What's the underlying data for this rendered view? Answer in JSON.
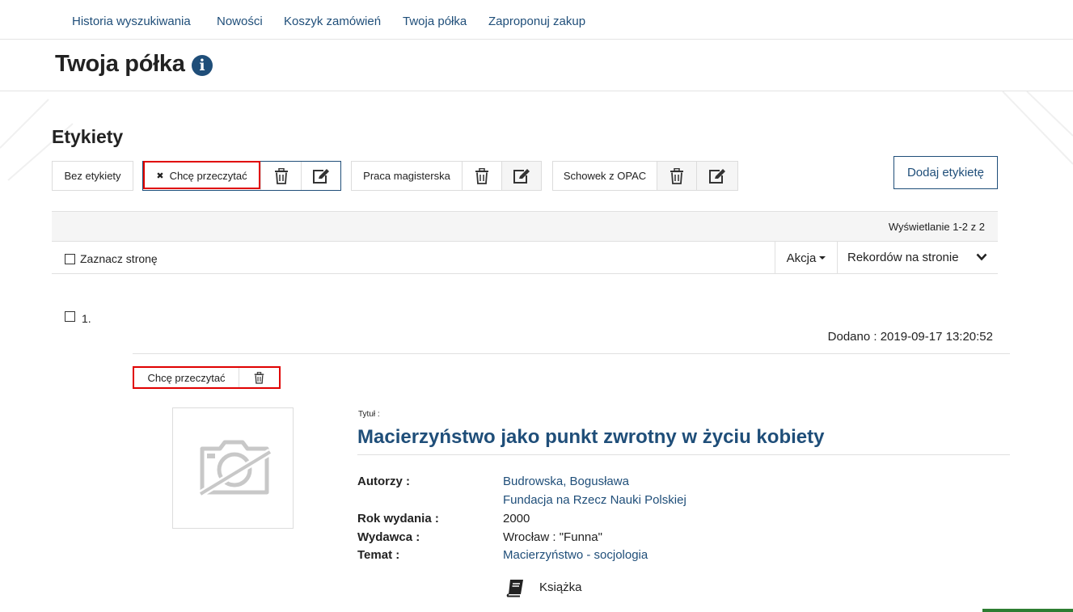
{
  "nav": {
    "items": [
      {
        "label": "Historia wyszukiwania"
      },
      {
        "label": "Nowości"
      },
      {
        "label": "Koszyk zamówień"
      },
      {
        "label": "Twoja półka"
      },
      {
        "label": "Zaproponuj zakup"
      }
    ]
  },
  "page": {
    "title": "Twoja półka",
    "info_icon_glyph": "i"
  },
  "labels_section": {
    "title": "Etykiety",
    "no_label": "Bez etykiety",
    "tags": [
      {
        "label": "Chcę przeczytać",
        "active": true,
        "remove_glyph": "✖"
      },
      {
        "label": "Praca magisterska",
        "active": false
      },
      {
        "label": "Schowek z OPAC",
        "active": false
      }
    ],
    "add_label_button": "Dodaj etykietę"
  },
  "results": {
    "count_text": "Wyświetlanie 1-2 z 2",
    "select_page_label": "Zaznacz stronę",
    "action_label": "Akcja",
    "per_page_label": "Rekordów na stronie"
  },
  "record": {
    "number": "1.",
    "added": "Dodano : 2019-09-17 13:20:52",
    "tag_label": "Chcę przeczytać",
    "title_label": "Tytuł :",
    "title": "Macierzyństwo jako punkt zwrotny w życiu kobiety",
    "fields": {
      "authors_label": "Autorzy :",
      "authors": [
        "Budrowska, Bogusława",
        "Fundacja na Rzecz Nauki Polskiej"
      ],
      "year_label": "Rok wydania :",
      "year": "2000",
      "publisher_label": "Wydawca :",
      "publisher": "Wrocław : \"Funna\"",
      "subject_label": "Temat :",
      "subject": "Macierzyństwo - socjologia"
    },
    "type": "Książka"
  },
  "colors": {
    "link": "#1f4e79",
    "highlight": "#e00000",
    "accent_green": "#2e7d32"
  },
  "icons": [
    "info-icon",
    "trash-icon",
    "edit-icon",
    "chevron-down-icon",
    "camera-off-icon",
    "book-icon"
  ]
}
